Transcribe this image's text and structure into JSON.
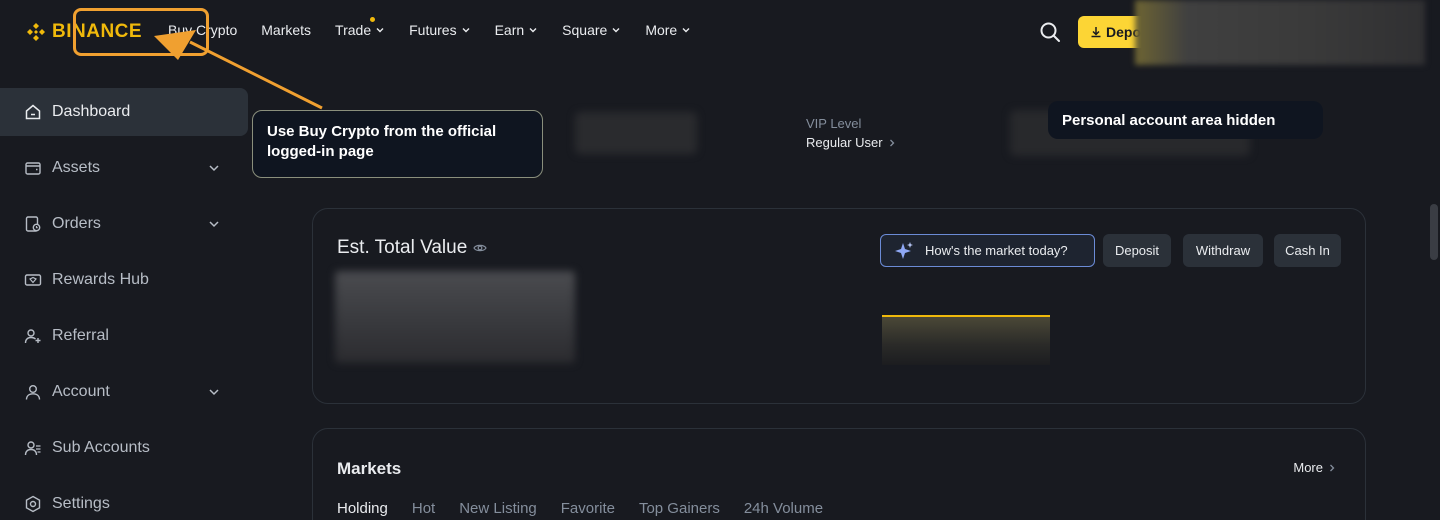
{
  "header": {
    "brand": "BINANCE",
    "nav": [
      {
        "label": "Buy Crypto",
        "dropdown": false
      },
      {
        "label": "Markets",
        "dropdown": false
      },
      {
        "label": "Trade",
        "dropdown": true
      },
      {
        "label": "Futures",
        "dropdown": true
      },
      {
        "label": "Earn",
        "dropdown": true
      },
      {
        "label": "Square",
        "dropdown": true
      },
      {
        "label": "More",
        "dropdown": true
      }
    ],
    "deposit_label": "Depo",
    "search_icon": "search-icon"
  },
  "sidebar": {
    "items": [
      {
        "label": "Dashboard",
        "icon": "home-icon",
        "active": true,
        "expandable": false
      },
      {
        "label": "Assets",
        "icon": "wallet-icon",
        "active": false,
        "expandable": true
      },
      {
        "label": "Orders",
        "icon": "orders-icon",
        "active": false,
        "expandable": true
      },
      {
        "label": "Rewards Hub",
        "icon": "ticket-icon",
        "active": false,
        "expandable": false
      },
      {
        "label": "Referral",
        "icon": "user-plus-icon",
        "active": false,
        "expandable": false
      },
      {
        "label": "Account",
        "icon": "user-icon",
        "active": false,
        "expandable": true
      },
      {
        "label": "Sub Accounts",
        "icon": "users-icon",
        "active": false,
        "expandable": false
      },
      {
        "label": "Settings",
        "icon": "gear-icon",
        "active": false,
        "expandable": false
      }
    ]
  },
  "profile": {
    "vip_label": "VIP Level",
    "vip_value": "Regular User"
  },
  "annotations": {
    "left": "Use Buy Crypto from the official logged-in page",
    "right": "Personal account area hidden"
  },
  "total_value": {
    "title": "Est. Total Value",
    "market_button": "How's the market today?",
    "actions": [
      "Deposit",
      "Withdraw",
      "Cash In"
    ]
  },
  "markets": {
    "title": "Markets",
    "more": "More",
    "tabs": [
      "Holding",
      "Hot",
      "New Listing",
      "Favorite",
      "Top Gainers",
      "24h Volume"
    ]
  },
  "colors": {
    "accent": "#f0b90b",
    "background": "#181a20",
    "annotation": "#f0a030"
  }
}
